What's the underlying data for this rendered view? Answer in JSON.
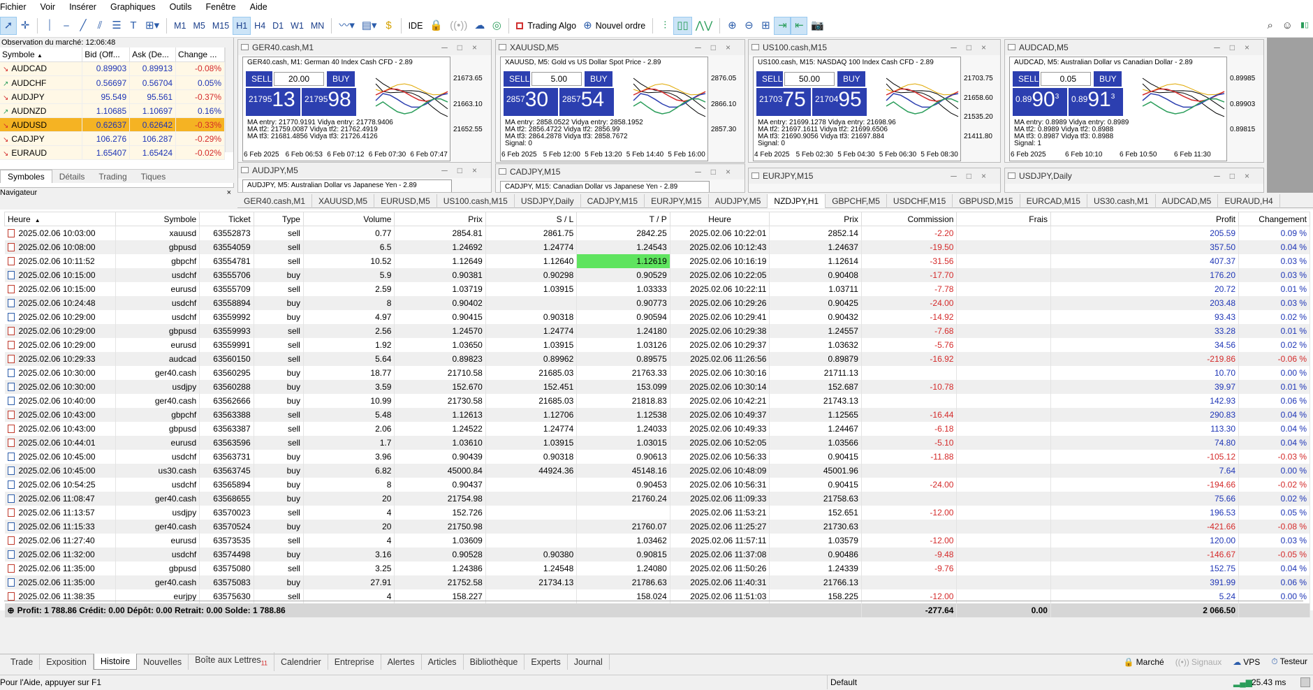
{
  "menu": [
    "Fichier",
    "Voir",
    "Insérer",
    "Graphiques",
    "Outils",
    "Fenêtre",
    "Aide"
  ],
  "toolbar": {
    "timeframes": [
      "M1",
      "M5",
      "M15",
      "H1",
      "H4",
      "D1",
      "W1",
      "MN"
    ],
    "active_tf": "H1",
    "ide": "IDE",
    "algo": "Trading Algo",
    "neworder": "Nouvel ordre"
  },
  "market_watch": {
    "title": "Observation du marché: 12:06:48",
    "headers": [
      "Symbole",
      "Bid (Off...",
      "Ask (De...",
      "Change ..."
    ],
    "rows": [
      {
        "sym": "AUDCAD",
        "bid": "0.89903",
        "ask": "0.89913",
        "chg": "-0.08%"
      },
      {
        "sym": "AUDCHF",
        "bid": "0.56697",
        "ask": "0.56704",
        "chg": "0.05%"
      },
      {
        "sym": "AUDJPY",
        "bid": "95.549",
        "ask": "95.561",
        "chg": "-0.37%"
      },
      {
        "sym": "AUDNZD",
        "bid": "1.10685",
        "ask": "1.10697",
        "chg": "0.16%"
      },
      {
        "sym": "AUDUSD",
        "bid": "0.62637",
        "ask": "0.62642",
        "chg": "-0.33%"
      },
      {
        "sym": "CADJPY",
        "bid": "106.276",
        "ask": "106.287",
        "chg": "-0.29%"
      },
      {
        "sym": "EURAUD",
        "bid": "1.65407",
        "ask": "1.65424",
        "chg": "-0.02%"
      }
    ],
    "tabs": [
      "Symboles",
      "Détails",
      "Trading",
      "Tiques"
    ],
    "navigator": "Navigateur"
  },
  "charts": [
    {
      "title": "GER40.cash,M1",
      "desc": "GER40.cash, M1:  German 40 Index Cash CFD - 2.89",
      "lot": "20.00",
      "bidp": "21795",
      "bids": "13",
      "askp": "21795",
      "asks": "98",
      "ind": [
        "MA entry: 21770.9191  Vidya entry: 21778.9406",
        "MA tf2: 21759.0087  Vidya tf2: 21762.4919",
        "MA tf3: 21681.4856  Vidya tf3: 21726.4126"
      ],
      "y": [
        "21673.65",
        "21663.10",
        "21652.55"
      ],
      "x": [
        "6 Feb 2025",
        "6 Feb 06:53",
        "6 Feb 07:12",
        "6 Feb 07:30",
        "6 Feb 07:47"
      ]
    },
    {
      "title": "XAUUSD,M5",
      "desc": "XAUUSD, M5:  Gold vs US Dollar Spot Price - 2.89",
      "lot": "5.00",
      "bidp": "2857",
      "bids": "30",
      "askp": "2857",
      "asks": "54",
      "ind": [
        "MA entry: 2858.0522  Vidya entry: 2858.1952",
        "MA tf2: 2856.4722  Vidya tf2: 2856.99",
        "MA tf3: 2864.2878  Vidya tf3: 2858.7672",
        "Signal: 0"
      ],
      "y": [
        "2876.05",
        "2866.10",
        "2857.30"
      ],
      "x": [
        "6 Feb 2025",
        "5 Feb 12:00",
        "5 Feb 13:20",
        "5 Feb 14:40",
        "5 Feb 16:00"
      ]
    },
    {
      "title": "US100.cash,M15",
      "desc": "US100.cash, M15:  NASDAQ 100 Index Cash CFD - 2.89",
      "lot": "50.00",
      "bidp": "21703",
      "bids": "75",
      "askp": "21704",
      "asks": "95",
      "ind": [
        "MA entry: 21699.1278  Vidya entry: 21698.96",
        "MA tf2: 21697.1611  Vidya tf2: 21699.6506",
        "MA tf3: 21690.9056  Vidya tf3: 21697.884",
        "Signal: 0"
      ],
      "y": [
        "21703.75",
        "21658.60",
        "21535.20",
        "21411.80"
      ],
      "x": [
        "4 Feb 2025",
        "5 Feb 02:30",
        "5 Feb 04:30",
        "5 Feb 06:30",
        "5 Feb 08:30"
      ]
    },
    {
      "title": "AUDCAD,M5",
      "desc": "AUDCAD, M5:  Australian Dollar vs Canadian Dollar - 2.89",
      "lot": "0.05",
      "bidp": "0.89",
      "bids": "90",
      "bidsup": "3",
      "askp": "0.89",
      "asks": "91",
      "asksup": "3",
      "ind": [
        "MA entry: 0.8989  Vidya entry: 0.8989",
        "MA tf2: 0.8989  Vidya tf2: 0.8988",
        "MA tf3: 0.8987  Vidya tf3: 0.8988",
        "Signal: 1"
      ],
      "y": [
        "0.89985",
        "0.89903",
        "0.89815"
      ],
      "x": [
        "6 Feb 2025",
        "6 Feb 10:10",
        "6 Feb 10:50",
        "6 Feb 11:30"
      ]
    }
  ],
  "mini_windows": [
    {
      "title": "AUDJPY,M5",
      "desc": "AUDJPY, M5:  Australian Dollar vs Japanese Yen - 2.89"
    },
    {
      "title": "CADJPY,M15",
      "desc": "CADJPY, M15:  Canadian Dollar vs Japanese Yen - 2.89"
    },
    {
      "title": "EURJPY,M15",
      "desc": ""
    },
    {
      "title": "USDJPY,Daily",
      "desc": ""
    }
  ],
  "chart_tabs": [
    "GER40.cash,M1",
    "XAUUSD,M5",
    "EURUSD,M5",
    "US100.cash,M15",
    "USDJPY,Daily",
    "CADJPY,M15",
    "EURJPY,M15",
    "AUDJPY,M5",
    "NZDJPY,H1",
    "GBPCHF,M5",
    "USDCHF,M15",
    "GBPUSD,M15",
    "EURCAD,M15",
    "US30.cash,M1",
    "AUDCAD,M5",
    "EURAUD,H4"
  ],
  "active_chart_tab": "NZDJPY,H1",
  "history": {
    "headers": [
      "Heure",
      "Symbole",
      "Ticket",
      "Type",
      "Volume",
      "Prix",
      "S / L",
      "T / P",
      "Heure",
      "Prix",
      "Commission",
      "Frais",
      "Profit",
      "Changement"
    ],
    "rows": [
      [
        "2025.02.06 10:03:00",
        "xauusd",
        "63552873",
        "sell",
        "0.77",
        "2854.81",
        "2861.75",
        "2842.25",
        "2025.02.06 10:22:01",
        "2852.14",
        "-2.20",
        "",
        "205.59",
        "0.09 %"
      ],
      [
        "2025.02.06 10:08:00",
        "gbpusd",
        "63554059",
        "sell",
        "6.5",
        "1.24692",
        "1.24774",
        "1.24543",
        "2025.02.06 10:12:43",
        "1.24637",
        "-19.50",
        "",
        "357.50",
        "0.04 %"
      ],
      [
        "2025.02.06 10:11:52",
        "gbpchf",
        "63554781",
        "sell",
        "10.52",
        "1.12649",
        "1.12640",
        "1.12619",
        "2025.02.06 10:16:19",
        "1.12614",
        "-31.56",
        "",
        "407.37",
        "0.03 %"
      ],
      [
        "2025.02.06 10:15:00",
        "usdchf",
        "63555706",
        "buy",
        "5.9",
        "0.90381",
        "0.90298",
        "0.90529",
        "2025.02.06 10:22:05",
        "0.90408",
        "-17.70",
        "",
        "176.20",
        "0.03 %"
      ],
      [
        "2025.02.06 10:15:00",
        "eurusd",
        "63555709",
        "sell",
        "2.59",
        "1.03719",
        "1.03915",
        "1.03333",
        "2025.02.06 10:22:11",
        "1.03711",
        "-7.78",
        "",
        "20.72",
        "0.01 %"
      ],
      [
        "2025.02.06 10:24:48",
        "usdchf",
        "63558894",
        "buy",
        "8",
        "0.90402",
        "",
        "0.90773",
        "2025.02.06 10:29:26",
        "0.90425",
        "-24.00",
        "",
        "203.48",
        "0.03 %"
      ],
      [
        "2025.02.06 10:29:00",
        "usdchf",
        "63559992",
        "buy",
        "4.97",
        "0.90415",
        "0.90318",
        "0.90594",
        "2025.02.06 10:29:41",
        "0.90432",
        "-14.92",
        "",
        "93.43",
        "0.02 %"
      ],
      [
        "2025.02.06 10:29:00",
        "gbpusd",
        "63559993",
        "sell",
        "2.56",
        "1.24570",
        "1.24774",
        "1.24180",
        "2025.02.06 10:29:38",
        "1.24557",
        "-7.68",
        "",
        "33.28",
        "0.01 %"
      ],
      [
        "2025.02.06 10:29:00",
        "eurusd",
        "63559991",
        "sell",
        "1.92",
        "1.03650",
        "1.03915",
        "1.03126",
        "2025.02.06 10:29:37",
        "1.03632",
        "-5.76",
        "",
        "34.56",
        "0.02 %"
      ],
      [
        "2025.02.06 10:29:33",
        "audcad",
        "63560150",
        "sell",
        "5.64",
        "0.89823",
        "0.89962",
        "0.89575",
        "2025.02.06 11:26:56",
        "0.89879",
        "-16.92",
        "",
        "-219.86",
        "-0.06 %"
      ],
      [
        "2025.02.06 10:30:00",
        "ger40.cash",
        "63560295",
        "buy",
        "18.77",
        "21710.58",
        "21685.03",
        "21763.33",
        "2025.02.06 10:30:16",
        "21711.13",
        "",
        "",
        "10.70",
        "0.00 %"
      ],
      [
        "2025.02.06 10:30:00",
        "usdjpy",
        "63560288",
        "buy",
        "3.59",
        "152.670",
        "152.451",
        "153.099",
        "2025.02.06 10:30:14",
        "152.687",
        "-10.78",
        "",
        "39.97",
        "0.01 %"
      ],
      [
        "2025.02.06 10:40:00",
        "ger40.cash",
        "63562666",
        "buy",
        "10.99",
        "21730.58",
        "21685.03",
        "21818.83",
        "2025.02.06 10:42:21",
        "21743.13",
        "",
        "",
        "142.93",
        "0.06 %"
      ],
      [
        "2025.02.06 10:43:00",
        "gbpchf",
        "63563388",
        "sell",
        "5.48",
        "1.12613",
        "1.12706",
        "1.12538",
        "2025.02.06 10:49:37",
        "1.12565",
        "-16.44",
        "",
        "290.83",
        "0.04 %"
      ],
      [
        "2025.02.06 10:43:00",
        "gbpusd",
        "63563387",
        "sell",
        "2.06",
        "1.24522",
        "1.24774",
        "1.24033",
        "2025.02.06 10:49:33",
        "1.24467",
        "-6.18",
        "",
        "113.30",
        "0.04 %"
      ],
      [
        "2025.02.06 10:44:01",
        "eurusd",
        "63563596",
        "sell",
        "1.7",
        "1.03610",
        "1.03915",
        "1.03015",
        "2025.02.06 10:52:05",
        "1.03566",
        "-5.10",
        "",
        "74.80",
        "0.04 %"
      ],
      [
        "2025.02.06 10:45:00",
        "usdchf",
        "63563731",
        "buy",
        "3.96",
        "0.90439",
        "0.90318",
        "0.90613",
        "2025.02.06 10:56:33",
        "0.90415",
        "-11.88",
        "",
        "-105.12",
        "-0.03 %"
      ],
      [
        "2025.02.06 10:45:00",
        "us30.cash",
        "63563745",
        "buy",
        "6.82",
        "45000.84",
        "44924.36",
        "45148.16",
        "2025.02.06 10:48:09",
        "45001.96",
        "",
        "",
        "7.64",
        "0.00 %"
      ],
      [
        "2025.02.06 10:54:25",
        "usdchf",
        "63565894",
        "buy",
        "8",
        "0.90437",
        "",
        "0.90453",
        "2025.02.06 10:56:31",
        "0.90415",
        "-24.00",
        "",
        "-194.66",
        "-0.02 %"
      ],
      [
        "2025.02.06 11:08:47",
        "ger40.cash",
        "63568655",
        "buy",
        "20",
        "21754.98",
        "",
        "21760.24",
        "2025.02.06 11:09:33",
        "21758.63",
        "",
        "",
        "75.66",
        "0.02 %"
      ],
      [
        "2025.02.06 11:13:57",
        "usdjpy",
        "63570023",
        "sell",
        "4",
        "152.726",
        "",
        "",
        "2025.02.06 11:53:21",
        "152.651",
        "-12.00",
        "",
        "196.53",
        "0.05 %"
      ],
      [
        "2025.02.06 11:15:33",
        "ger40.cash",
        "63570524",
        "buy",
        "20",
        "21750.98",
        "",
        "21760.07",
        "2025.02.06 11:25:27",
        "21730.63",
        "",
        "",
        "-421.66",
        "-0.08 %"
      ],
      [
        "2025.02.06 11:27:40",
        "eurusd",
        "63573535",
        "sell",
        "4",
        "1.03609",
        "",
        "1.03462",
        "2025.02.06 11:57:11",
        "1.03579",
        "-12.00",
        "",
        "120.00",
        "0.03 %"
      ],
      [
        "2025.02.06 11:32:00",
        "usdchf",
        "63574498",
        "buy",
        "3.16",
        "0.90528",
        "0.90380",
        "0.90815",
        "2025.02.06 11:37:08",
        "0.90486",
        "-9.48",
        "",
        "-146.67",
        "-0.05 %"
      ],
      [
        "2025.02.06 11:35:00",
        "gbpusd",
        "63575080",
        "sell",
        "3.25",
        "1.24386",
        "1.24548",
        "1.24080",
        "2025.02.06 11:50:26",
        "1.24339",
        "-9.76",
        "",
        "152.75",
        "0.04 %"
      ],
      [
        "2025.02.06 11:35:00",
        "ger40.cash",
        "63575083",
        "buy",
        "27.91",
        "21752.58",
        "21734.13",
        "21786.63",
        "2025.02.06 11:40:31",
        "21766.13",
        "",
        "",
        "391.99",
        "0.06 %"
      ],
      [
        "2025.02.06 11:38:35",
        "eurjpy",
        "63575630",
        "sell",
        "4",
        "158.227",
        "",
        "158.024",
        "2025.02.06 11:51:03",
        "158.225",
        "-12.00",
        "",
        "5.24",
        "0.00 %"
      ]
    ],
    "summary": "Profit: 1 788.86  Crédit: 0.00  Dépôt: 0.00  Retrait: 0.00  Solde: 1 788.86",
    "total_commission": "-277.64",
    "total_fees": "0.00",
    "total_profit": "2 066.50"
  },
  "bottom_tabs": [
    "Trade",
    "Exposition",
    "Histoire",
    "Nouvelles",
    "Boîte aux Lettres",
    "Calendrier",
    "Entreprise",
    "Alertes",
    "Articles",
    "Bibliothèque",
    "Experts",
    "Journal"
  ],
  "active_bottom_tab": "Histoire",
  "mail_count": "11",
  "bottom_right": {
    "market": "Marché",
    "signals": "Signaux",
    "vps": "VPS",
    "tester": "Testeur"
  },
  "status": {
    "help": "Pour l'Aide, appuyer sur F1",
    "profile": "Default",
    "ping": "25.43 ms"
  },
  "colors": {
    "accent": "#2c3fb0",
    "profit": "#1e35b6",
    "loss": "#d42a2a",
    "highlight": "#f5b323",
    "tp_hit": "#5fe45f"
  }
}
